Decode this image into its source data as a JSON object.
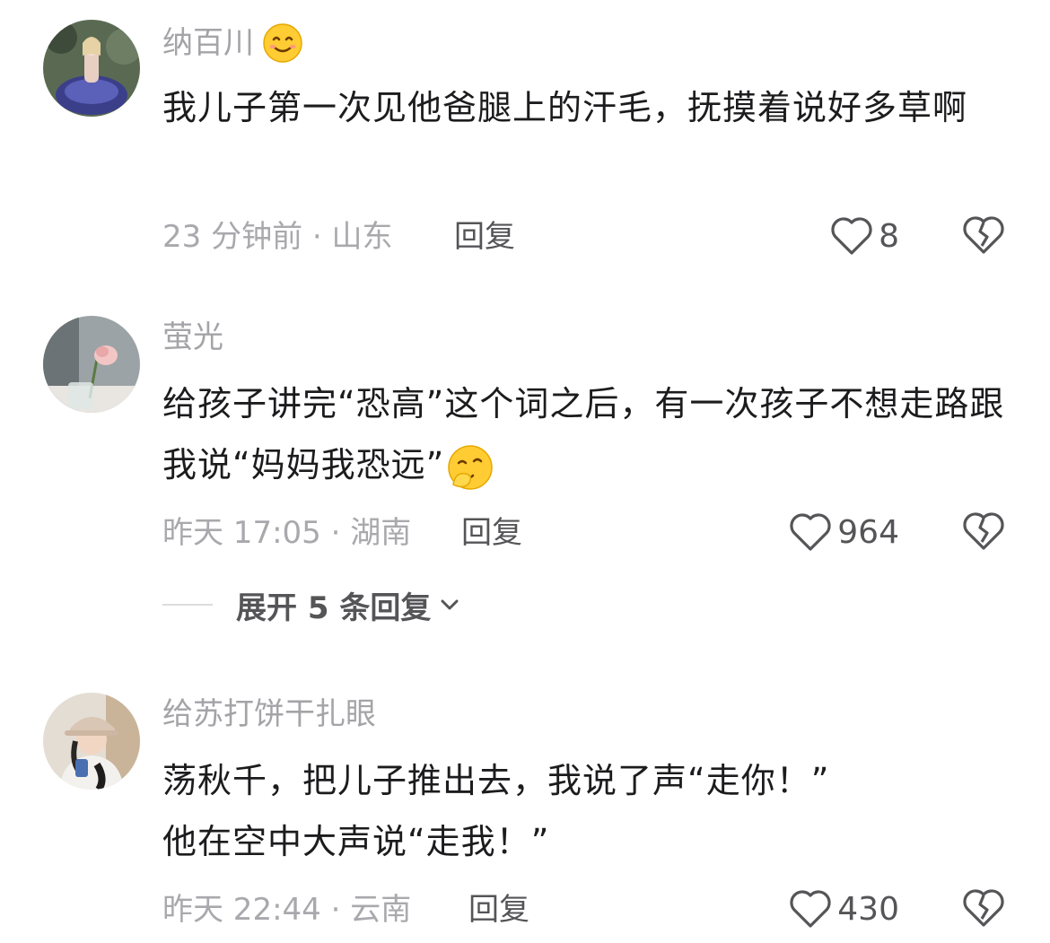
{
  "comments": [
    {
      "username": "纳百川",
      "text": "我儿子第一次见他爸腿上的汗毛，抚摸着说好多草啊",
      "meta": "23 分钟前 · 山东",
      "reply_label": "回复",
      "likes": "8",
      "username_emoji": "smile-emoji"
    },
    {
      "username": "萤光",
      "text": "给孩子讲完“恐高”这个词之后，有一次孩子不想走路跟我说“妈妈我恐远”",
      "meta": "昨天 17:05 · 湖南",
      "reply_label": "回复",
      "likes": "964",
      "text_emoji": "snicker-emoji"
    },
    {
      "username": "给苏打饼干扎眼",
      "text_line1": "荡秋千，把儿子推出去，我说了声“走你！”",
      "text_line2": "他在空中大声说“走我！”",
      "meta": "昨天 22:44 · 云南",
      "reply_label": "回复",
      "likes": "430"
    }
  ],
  "expand_replies": "展开 5 条回复"
}
